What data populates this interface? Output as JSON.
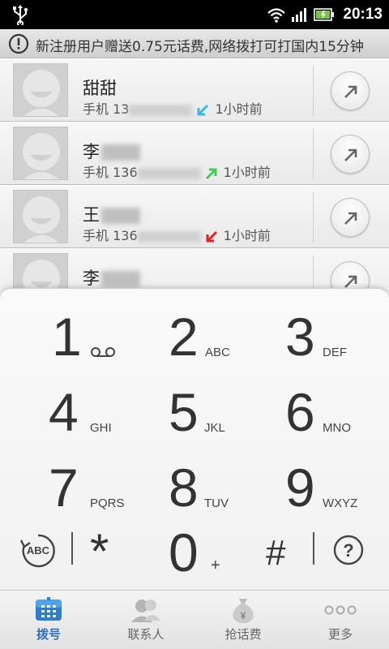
{
  "status_bar": {
    "time": "20:13"
  },
  "notice": {
    "text": "新注册用户赠送0.75元话费,网络拨打可打国内15分钟"
  },
  "call_log": [
    {
      "name": "甜甜",
      "name_blurred": false,
      "label": "手机",
      "number_visible": "13",
      "type": "incoming",
      "time": "1小时前"
    },
    {
      "name": "李",
      "name_blurred": true,
      "label": "手机",
      "number_visible": "136",
      "type": "outgoing",
      "time": "1小时前"
    },
    {
      "name": "王",
      "name_blurred": true,
      "label": "手机",
      "number_visible": "136",
      "type": "missed",
      "time": "1小时前"
    },
    {
      "name": "李",
      "name_blurred": true
    }
  ],
  "dialpad": {
    "keys": [
      {
        "digit": "1",
        "letters": ""
      },
      {
        "digit": "2",
        "letters": "ABC"
      },
      {
        "digit": "3",
        "letters": "DEF"
      },
      {
        "digit": "4",
        "letters": "GHI"
      },
      {
        "digit": "5",
        "letters": "JKL"
      },
      {
        "digit": "6",
        "letters": "MNO"
      },
      {
        "digit": "7",
        "letters": "PQRS"
      },
      {
        "digit": "8",
        "letters": "TUV"
      },
      {
        "digit": "9",
        "letters": "WXYZ"
      },
      {
        "digit": "0",
        "letters": "+"
      }
    ],
    "star": "*",
    "hash": "#",
    "abc_label": "ABC",
    "help_label": "?"
  },
  "tabs": [
    {
      "label": "拨号",
      "icon": "dialpad-icon",
      "active": true
    },
    {
      "label": "联系人",
      "icon": "contacts-icon",
      "active": false
    },
    {
      "label": "抢话费",
      "icon": "money-bag-icon",
      "active": false
    },
    {
      "label": "更多",
      "icon": "more-icon",
      "active": false
    }
  ],
  "colors": {
    "incoming_arrow": "#3bb6e6",
    "outgoing_arrow": "#3fcc55",
    "missed_arrow": "#e8231e",
    "active_tab": "#2a6fbf"
  }
}
